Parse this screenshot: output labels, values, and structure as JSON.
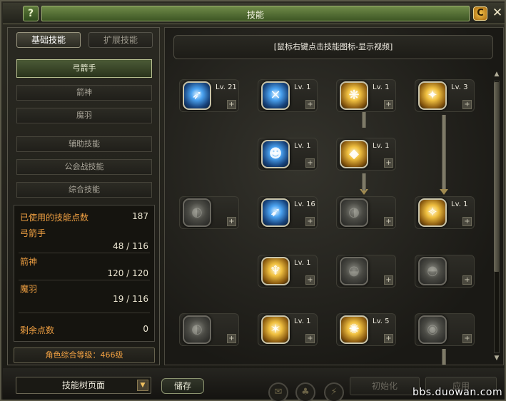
{
  "window": {
    "title": "技能",
    "help_label": "?",
    "c_label": "C",
    "close_label": "✕"
  },
  "tabs": [
    {
      "label": "基础技能"
    },
    {
      "label": "扩展技能"
    }
  ],
  "categories": [
    {
      "label": "弓箭手"
    },
    {
      "label": "箭神"
    },
    {
      "label": "魔羽"
    },
    {
      "label": "辅助技能"
    },
    {
      "label": "公会战技能"
    },
    {
      "label": "综合技能"
    }
  ],
  "stats": {
    "used_label": "已使用的技能点数",
    "used_value": "187",
    "archer_label": "弓箭手",
    "archer_value": "48 / 116",
    "arrow_god_label": "箭神",
    "arrow_god_value": "120 / 120",
    "demon_feather_label": "魔羽",
    "demon_feather_value": "19 / 116",
    "remaining_label": "剩余点数",
    "remaining_value": "0"
  },
  "character_level": "角色综合等级：466级",
  "hint": "[鼠标右键点击技能图标-显示视频]",
  "skill_slots": [
    {
      "level": "Lv. 21",
      "style": "blue",
      "icon": "bow-wind-icon"
    },
    {
      "level": "Lv. 1",
      "style": "blue",
      "icon": "crossed-arrows-icon"
    },
    {
      "level": "Lv. 1",
      "style": "gold",
      "icon": "phoenix-icon"
    },
    {
      "level": "Lv. 3",
      "style": "gold",
      "icon": "radiant-arrow-icon"
    },
    {
      "level": "Lv. 1",
      "style": "blue",
      "icon": "crouching-archer-icon"
    },
    {
      "level": "Lv. 1",
      "style": "gold",
      "icon": "golden-boot-icon"
    },
    {
      "level": "",
      "style": "gray",
      "icon": "locked-rune-icon"
    },
    {
      "level": "Lv. 16",
      "style": "blue",
      "icon": "piercing-arrow-icon"
    },
    {
      "level": "",
      "style": "gray",
      "icon": "locked-claw-icon"
    },
    {
      "level": "Lv. 1",
      "style": "gold",
      "icon": "golden-ray-icon"
    },
    {
      "level": "Lv. 1",
      "style": "gold",
      "icon": "winged-figure-icon"
    },
    {
      "level": "",
      "style": "gray",
      "icon": "locked-leap-icon"
    },
    {
      "level": "",
      "style": "gray",
      "icon": "locked-aura-icon"
    },
    {
      "level": "",
      "style": "gray",
      "icon": "locked-wing-icon"
    },
    {
      "level": "Lv. 1",
      "style": "gold",
      "icon": "kick-icon"
    },
    {
      "level": "Lv. 5",
      "style": "gold",
      "icon": "burst-icon"
    },
    {
      "level": "",
      "style": "gray",
      "icon": "locked-flare-icon"
    }
  ],
  "bottom": {
    "dropdown_value": "技能树页面",
    "save_label": "储存",
    "reset_label": "初始化",
    "apply_label": "应用",
    "watermark": "bbs.duowan.com"
  }
}
